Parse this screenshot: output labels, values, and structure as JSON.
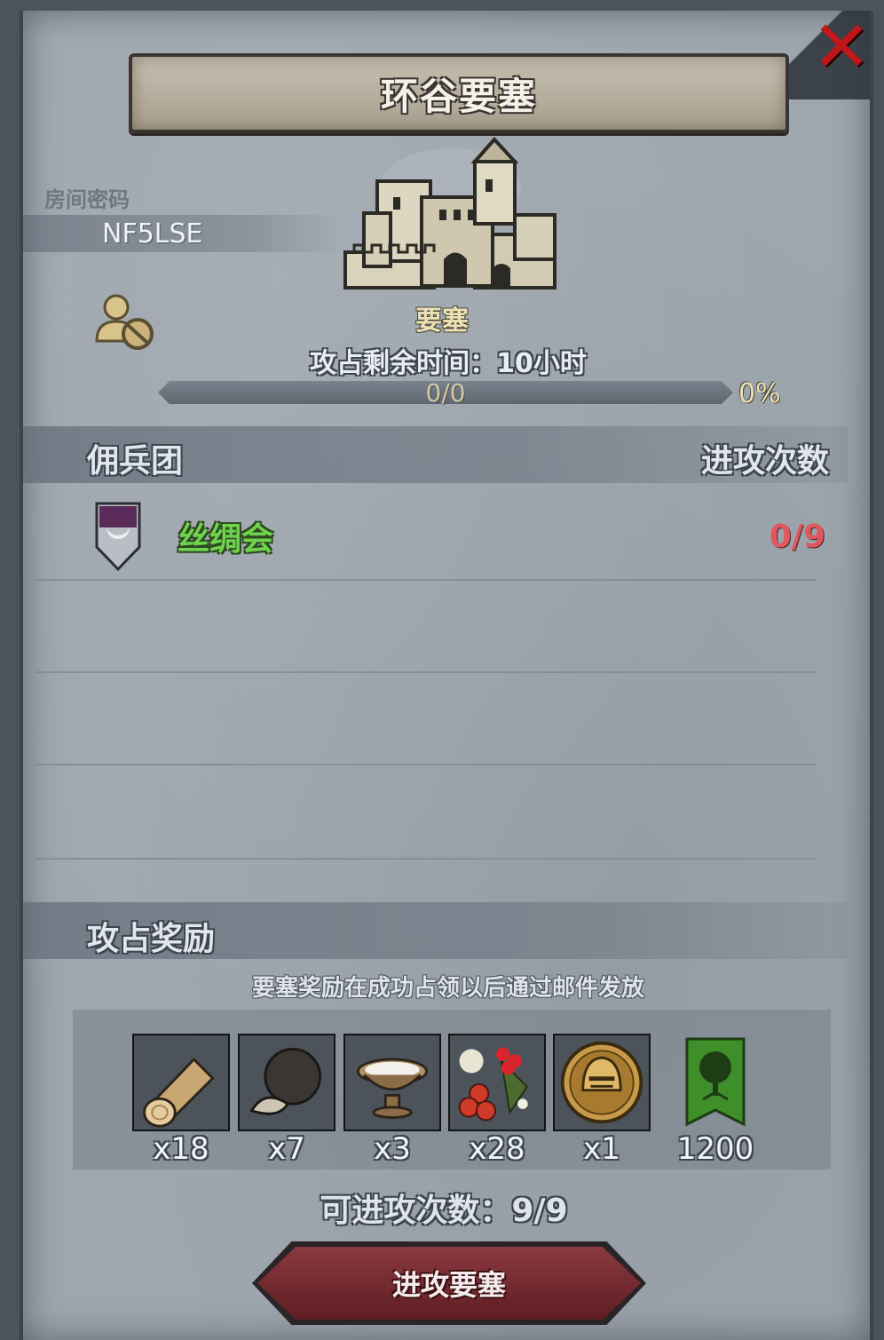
{
  "header": {
    "title": "环谷要塞"
  },
  "room": {
    "label": "房间密码",
    "code": "NF5LSE"
  },
  "fortress": {
    "label": "要塞",
    "time_remaining": "攻占剩余时间：10小时",
    "progress_text": "0/0",
    "progress_percent": "0%",
    "progress_value": 0
  },
  "mercenary": {
    "section_title": "佣兵团",
    "column_attacks": "进攻次数",
    "rows": [
      {
        "name": "丝绸会",
        "attacks": "0/9"
      }
    ]
  },
  "rewards": {
    "section_title": "攻占奖励",
    "note": "要塞奖励在成功占领以后通过邮件发放",
    "items": [
      {
        "icon": "wood-log-icon",
        "qty": "x18"
      },
      {
        "icon": "truffle-icon",
        "qty": "x7"
      },
      {
        "icon": "milk-bowl-icon",
        "qty": "x3"
      },
      {
        "icon": "berries-icon",
        "qty": "x28"
      },
      {
        "icon": "knight-helmet-coin-icon",
        "qty": "x1"
      },
      {
        "icon": "tree-banner-icon",
        "qty": "1200"
      }
    ]
  },
  "attempts": "可进攻次数：9/9",
  "actions": {
    "attack_label": "进攻要塞"
  },
  "colors": {
    "guild_name": "#6fd34e",
    "attack_count": "#e0575c",
    "close": "#c0171a"
  }
}
